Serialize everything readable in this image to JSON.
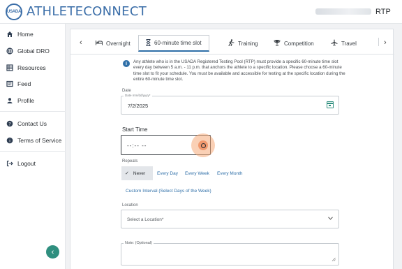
{
  "header": {
    "logo_text": "USADA",
    "brand": "ATHLETECONNECT",
    "role": "RTP"
  },
  "sidebar": {
    "items": [
      {
        "label": "Home",
        "icon": "home-icon"
      },
      {
        "label": "Global DRO",
        "icon": "globe-icon"
      },
      {
        "label": "Resources",
        "icon": "grid-icon"
      },
      {
        "label": "Feed",
        "icon": "feed-icon"
      },
      {
        "label": "Profile",
        "icon": "user-icon"
      },
      {
        "label": "Contact Us",
        "icon": "question-icon"
      },
      {
        "label": "Terms of Service",
        "icon": "info-icon"
      },
      {
        "label": "Logout",
        "icon": "logout-icon"
      }
    ],
    "collapse_glyph": "‹"
  },
  "tabs": {
    "prev_glyph": "‹",
    "next_glyph": "›",
    "items": [
      {
        "label": "Overnight",
        "icon": "bed-icon",
        "glyph": "🛏"
      },
      {
        "label": "60-minute time slot",
        "icon": "hourglass-icon",
        "glyph": "⧗",
        "active": true
      },
      {
        "label": "Training",
        "icon": "running-icon",
        "glyph": "🏃"
      },
      {
        "label": "Competition",
        "icon": "trophy-icon",
        "glyph": "🏆"
      },
      {
        "label": "Travel",
        "icon": "plane-icon",
        "glyph": "✈"
      }
    ]
  },
  "info": {
    "icon_glyph": "i",
    "text": "Any athlete who is in the USADA Registered Testing Pool (RTP) must provide a specific 60-minute time slot every day between 5 a.m. - 11 p.m. that anchors the athlete to a specific location. Please choose a 60-minute time slot to fit your schedule. You must be available and accessible for testing at the specific location during the entire 60-minute time slot."
  },
  "form": {
    "date_label": "Date",
    "date_hint": "Date mm/dd/yyyy*",
    "date_value": "7/2/2025",
    "start_time_label": "Start Time",
    "start_time_value": "--:-- --",
    "repeats_label": "Repeats",
    "repeat_options": [
      "Never",
      "Every Day",
      "Every Week",
      "Every Month"
    ],
    "repeat_selected": "Never",
    "check_glyph": "✓",
    "custom_interval": "Custom Interval (Select Days of the Week)",
    "location_label": "Location",
    "location_placeholder": "Select a Location*",
    "note_placeholder": "Note: (Optional)"
  },
  "colors": {
    "brand_blue": "#3b6ea8",
    "accent_teal": "#2f8f7f",
    "link_blue": "#2f6fa8"
  }
}
